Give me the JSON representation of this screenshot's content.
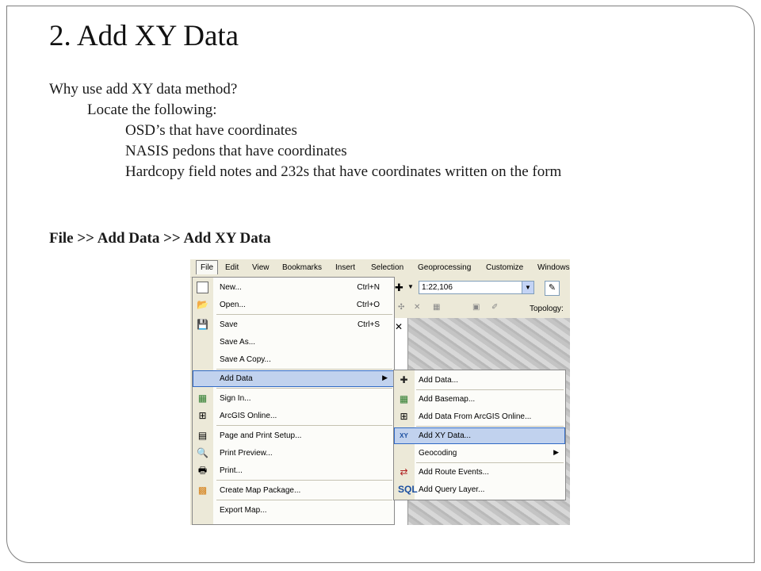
{
  "slide": {
    "title": "2. Add XY Data",
    "lines": [
      "Why use add XY data method?",
      "Locate the following:",
      "OSD’s that have coordinates",
      "NASIS pedons that have coordinates",
      "Hardcopy field notes and 232s that have coordinates written on the form"
    ],
    "path": "File >> Add Data >> Add XY Data"
  },
  "screenshot": {
    "menubar": [
      "File",
      "Edit",
      "View",
      "Bookmarks",
      "Insert",
      "Selection",
      "Geoprocessing",
      "Customize",
      "Windows"
    ],
    "scale": "1:22,106",
    "topology_label": "Topology:",
    "file_menu": [
      {
        "label": "New...",
        "shortcut": "Ctrl+N",
        "icon": "new-document-icon"
      },
      {
        "label": "Open...",
        "shortcut": "Ctrl+O",
        "icon": "open-folder-icon"
      },
      {
        "label": "Save",
        "shortcut": "Ctrl+S",
        "icon": "save-disk-icon"
      },
      {
        "label": "Save As...",
        "shortcut": "",
        "icon": ""
      },
      {
        "label": "Save A Copy...",
        "shortcut": "",
        "icon": ""
      },
      {
        "label": "Add Data",
        "shortcut": "",
        "icon": "",
        "highlighted": true,
        "submenu": true
      },
      {
        "label": "Sign In...",
        "shortcut": "",
        "icon": "sign-in-icon"
      },
      {
        "label": "ArcGIS Online...",
        "shortcut": "",
        "icon": "arcgis-online-icon"
      },
      {
        "label": "Page and Print Setup...",
        "shortcut": "",
        "icon": "page-setup-icon"
      },
      {
        "label": "Print Preview...",
        "shortcut": "",
        "icon": "print-preview-icon"
      },
      {
        "label": "Print...",
        "shortcut": "",
        "icon": "printer-icon"
      },
      {
        "label": "Create Map Package...",
        "shortcut": "",
        "icon": "map-package-icon"
      },
      {
        "label": "Export Map...",
        "shortcut": "",
        "icon": ""
      }
    ],
    "add_data_submenu": [
      {
        "label": "Add Data...",
        "icon": "add-data-icon"
      },
      {
        "label": "Add Basemap...",
        "icon": "basemap-icon"
      },
      {
        "label": "Add Data From ArcGIS Online...",
        "icon": "arcgis-online-data-icon"
      },
      {
        "label": "Add XY Data...",
        "icon": "xy-data-icon",
        "highlighted": true
      },
      {
        "label": "Geocoding",
        "icon": "",
        "submenu": true
      },
      {
        "label": "Add Route Events...",
        "icon": "route-events-icon"
      },
      {
        "label": "Add Query Layer...",
        "icon": "sql-query-icon"
      }
    ],
    "colors": {
      "highlight": "#c1d2ee",
      "highlight_border": "#316ac5",
      "menu_bg": "#fcfcf9",
      "chrome": "#ece9d8"
    }
  }
}
